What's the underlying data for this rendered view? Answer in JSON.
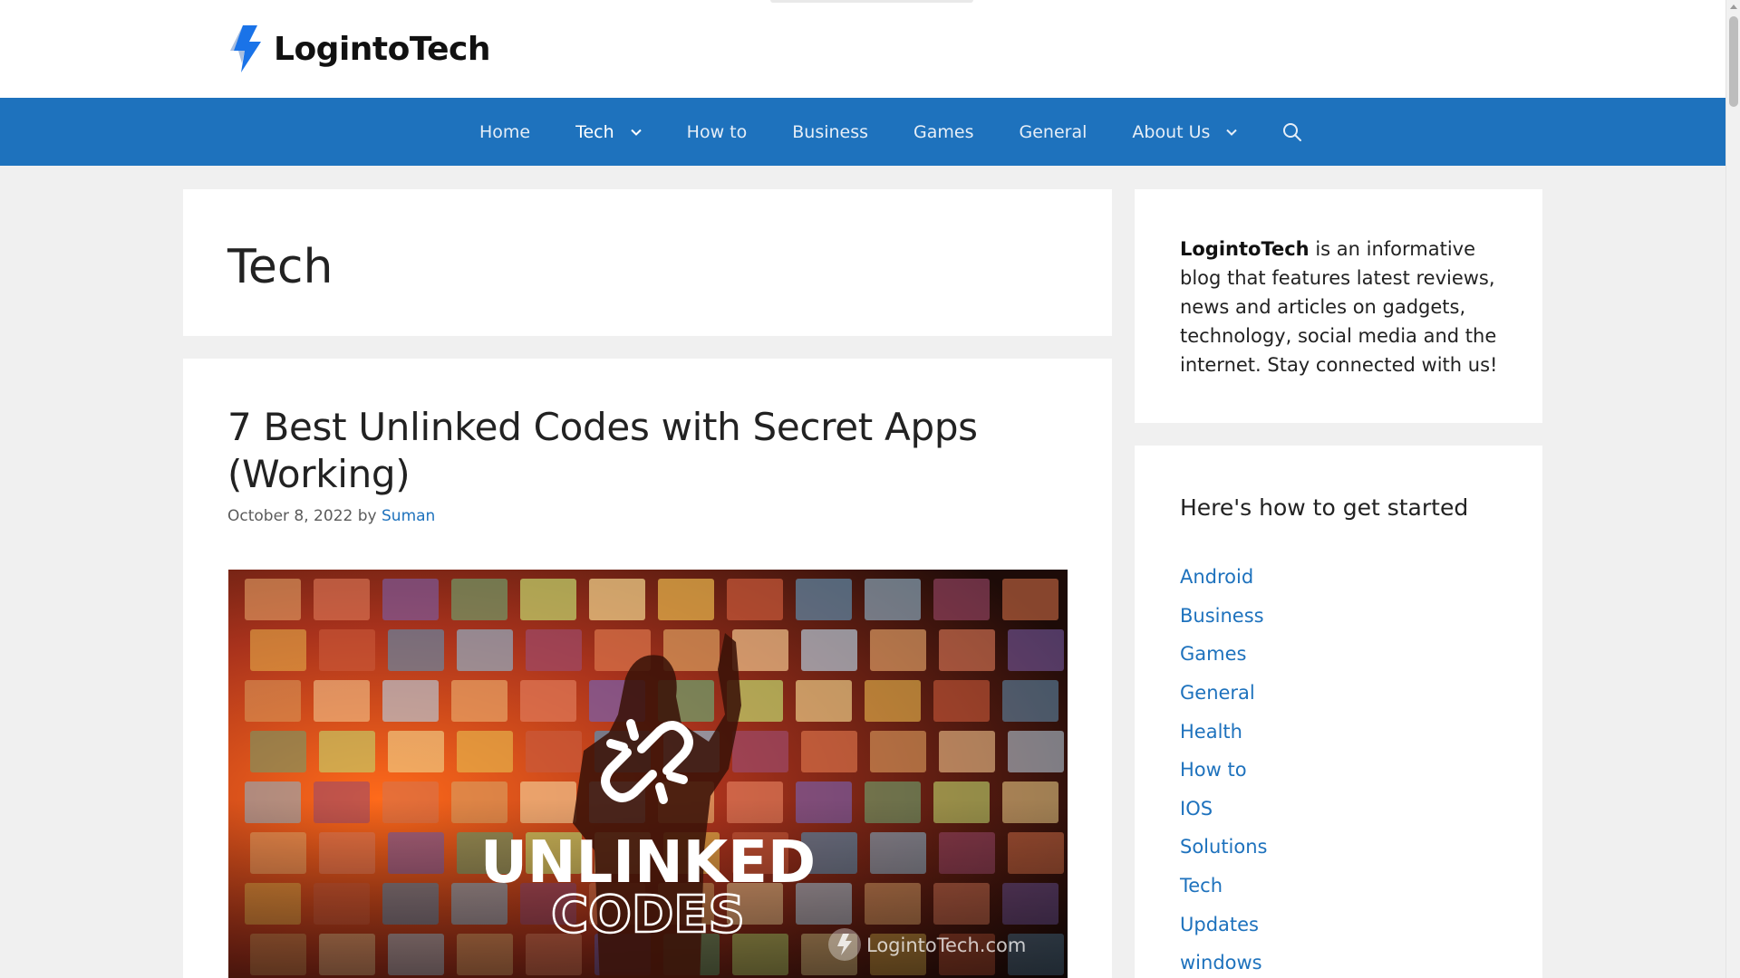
{
  "site": {
    "name": "LogintoTech",
    "logo_icon": "lightning-bolt-icon",
    "colors": {
      "primary": "#1e72bd",
      "logo_blue": "#1a73e8",
      "background": "#f0f0f0"
    }
  },
  "nav": {
    "items": [
      {
        "label": "Home",
        "has_dropdown": false
      },
      {
        "label": "Tech",
        "has_dropdown": true,
        "active": true
      },
      {
        "label": "How to",
        "has_dropdown": false
      },
      {
        "label": "Business",
        "has_dropdown": false
      },
      {
        "label": "Games",
        "has_dropdown": false
      },
      {
        "label": "General",
        "has_dropdown": false
      },
      {
        "label": "About Us",
        "has_dropdown": true
      }
    ],
    "search_icon": "search-icon"
  },
  "archive": {
    "title": "Tech"
  },
  "post": {
    "title": "7 Best Unlinked Codes with Secret Apps (Working)",
    "date": "October 8, 2022",
    "by": "by",
    "author": "Suman",
    "image": {
      "headline_1": "UNLINKED",
      "headline_2": "CODES",
      "watermark": "LogintoTech.com",
      "icon": "broken-link-icon"
    }
  },
  "sidebar": {
    "about": {
      "brand": "LogintoTech",
      "text": " is an informative blog that features latest reviews, news and articles on gadgets, technology, social media and the internet. Stay connected with us!"
    },
    "categories": {
      "title": "Here's how to get started",
      "items": [
        "Android",
        "Business",
        "Games",
        "General",
        "Health",
        "How to",
        "IOS",
        "Solutions",
        "Tech",
        "Updates",
        "windows"
      ]
    }
  }
}
